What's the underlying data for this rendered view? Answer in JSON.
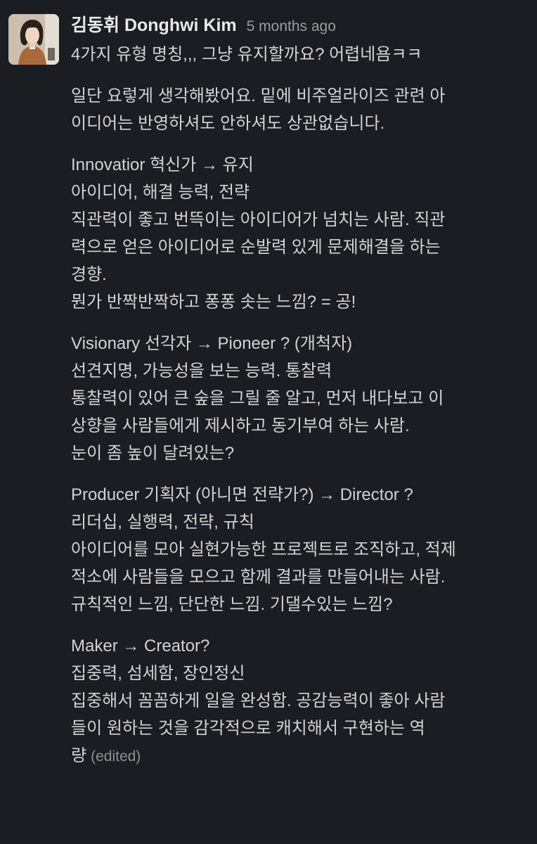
{
  "message": {
    "sender": "김동휘 Donghwi Kim",
    "timestamp": "5 months ago",
    "first_line": "4가지 유형 명칭,,, 그냥 유지할까요? 어렵네욤ㅋㅋ",
    "intro": [
      "일단 요렇게 생각해봤어요. 밑에 비주얼라이즈 관련 아",
      "이디어는 반영하셔도 안하셔도 상관없습니다."
    ],
    "sections": [
      {
        "lines": [
          "Innovatior 혁신가 → 유지",
          "아이디어, 해결 능력, 전략",
          "직관력이 좋고 번뜩이는 아이디어가 넘치는 사람. 직관",
          "력으로 얻은 아이디어로 순발력 있게 문제해결을 하는",
          "경향.",
          "뭔가 반짝반짝하고 퐁퐁 솟는 느낌? = 공!"
        ]
      },
      {
        "lines": [
          "Visionary 선각자 → Pioneer ? (개척자)",
          "선견지명, 가능성을 보는 능력. 통찰력",
          "통찰력이 있어 큰 숲을 그릴 줄 알고, 먼저 내다보고 이",
          "상향을 사람들에게 제시하고 동기부여 하는 사람.",
          "눈이 좀 높이 달려있는?"
        ]
      },
      {
        "lines": [
          "Producer 기획자 (아니면 전략가?) → Director ?",
          "리더십, 실행력, 전략, 규칙",
          "아이디어를 모아 실현가능한 프로젝트로 조직하고, 적제",
          "적소에 사람들을 모으고 함께 결과를 만들어내는 사람.",
          "규칙적인 느낌, 단단한 느낌. 기댈수있는 느낌?"
        ]
      },
      {
        "lines": [
          "Maker → Creator?",
          "집중력, 섬세함, 장인정신",
          "집중해서 꼼꼼하게 일을 완성함. 공감능력이 좋아 사람",
          "들이 원하는 것을 감각적으로 캐치해서 구현하는 역",
          "량"
        ]
      }
    ],
    "edited_label": "(edited)"
  },
  "colors": {
    "background": "#1a1d21",
    "text": "#d1d2d3",
    "muted": "#9a9b9d"
  }
}
